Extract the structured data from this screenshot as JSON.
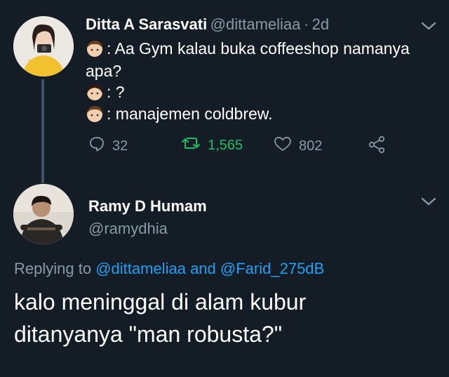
{
  "tweet1": {
    "name": "Ditta A Sarasvati",
    "handle": "@dittameliaa",
    "sep": "·",
    "time": "2d",
    "lines": [
      ": Aa Gym kalau buka coffeeshop namanya",
      "apa?",
      ": ?",
      ": manajemen coldbrew."
    ],
    "actions": {
      "replies": "32",
      "retweets": "1,565",
      "likes": "802"
    }
  },
  "tweet2": {
    "name": "Ramy D Humam",
    "handle": "@ramydhia",
    "replying_prefix": "Replying to",
    "reply_user1": "@dittameliaa",
    "reply_and": "and",
    "reply_user2": "@Farid_275dB",
    "text_line1": "kalo meninggal di alam kubur",
    "text_line2": "ditanyanya \"man robusta?\""
  },
  "colors": {
    "background": "#141d26",
    "secondary_text": "#8899a6",
    "link": "#1da1f2",
    "retweet_green": "#17bf63"
  },
  "icons": [
    "reply-icon",
    "retweet-icon",
    "like-icon",
    "share-icon",
    "chevron-down-icon"
  ]
}
